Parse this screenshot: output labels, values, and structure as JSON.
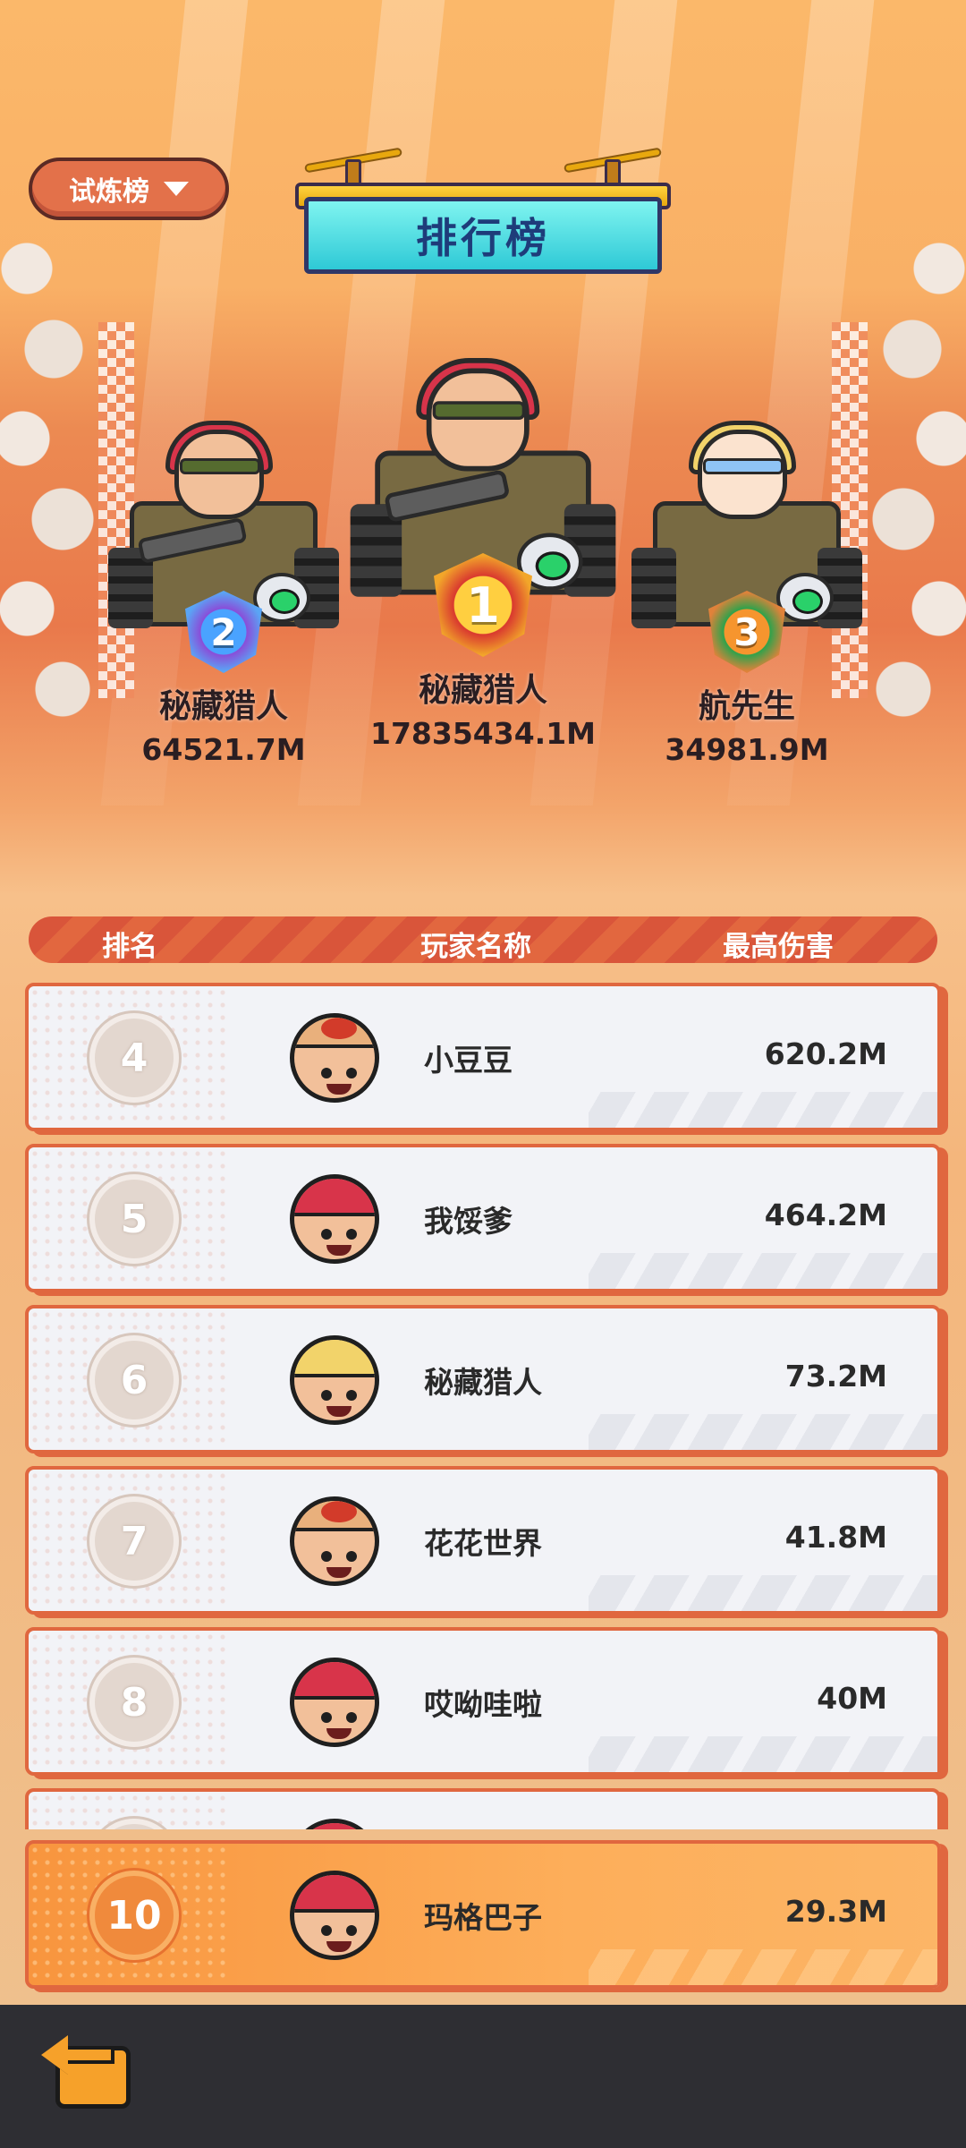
{
  "header": {
    "mode_selector_label": "试炼榜",
    "title": "排行榜"
  },
  "podium": [
    {
      "rank": "1",
      "name": "秘藏猎人",
      "score": "17835434.1M"
    },
    {
      "rank": "2",
      "name": "秘藏猎人",
      "score": "64521.7M"
    },
    {
      "rank": "3",
      "name": "航先生",
      "score": "34981.9M"
    }
  ],
  "table": {
    "columns": {
      "rank": "排名",
      "player": "玩家名称",
      "damage": "最高伤害"
    },
    "rows": [
      {
        "rank": "4",
        "name": "小豆豆",
        "damage": "620.2M",
        "avatar": "monk-avatar"
      },
      {
        "rank": "5",
        "name": "我馁爹",
        "damage": "464.2M",
        "avatar": "red-hair-avatar"
      },
      {
        "rank": "6",
        "name": "秘藏猎人",
        "damage": "73.2M",
        "avatar": "blonde-avatar"
      },
      {
        "rank": "7",
        "name": "花花世界",
        "damage": "41.8M",
        "avatar": "monk-avatar"
      },
      {
        "rank": "8",
        "name": "哎呦哇啦",
        "damage": "40M",
        "avatar": "red-hair-avatar"
      }
    ]
  },
  "my_rank": {
    "rank": "10",
    "name": "玛格巴子",
    "damage": "29.3M",
    "avatar": "red-hair-avatar"
  },
  "footer": {
    "back_icon": "back-arrow-icon"
  },
  "colors": {
    "accent": "#e0673f",
    "title_board": "#2ec9d6",
    "my_row": "#fdae5a",
    "bottom_bar": "#2e2e33"
  }
}
